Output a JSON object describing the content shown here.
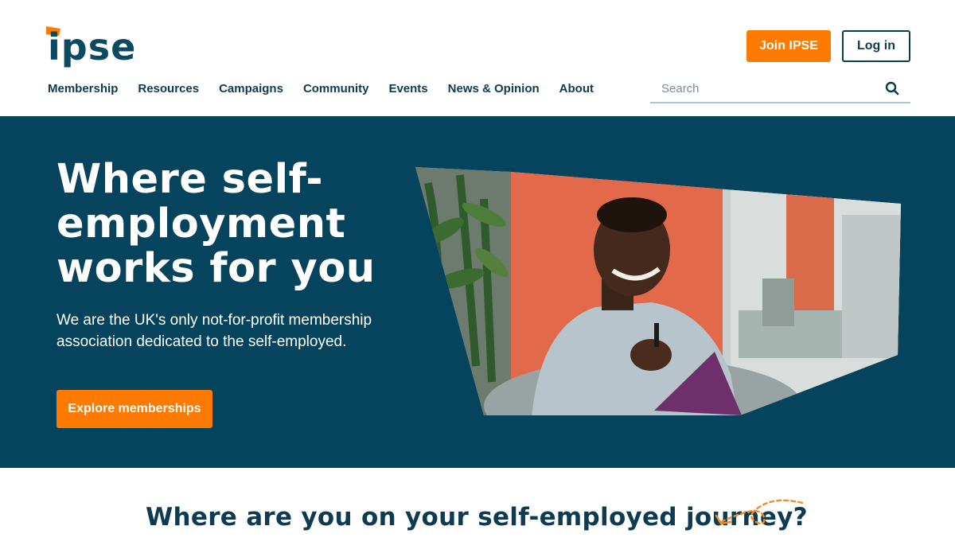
{
  "brand": {
    "logo_text": "ipse",
    "accent": "#ff7a00",
    "navy": "#06435c"
  },
  "header": {
    "join_label": "Join IPSE",
    "login_label": "Log in",
    "nav": [
      "Membership",
      "Resources",
      "Campaigns",
      "Community",
      "Events",
      "News & Opinion",
      "About"
    ],
    "search_placeholder": "Search"
  },
  "hero": {
    "title": "Where self-employment works for you",
    "subtitle": "We are the UK's only not-for-profit membership association dedicated to the self-employed.",
    "cta_label": "Explore memberships",
    "image_icon": "hero-photo"
  },
  "journey": {
    "title": "Where are you on your self-employed journey?",
    "arrow_icon": "doodle-arrow-icon"
  }
}
